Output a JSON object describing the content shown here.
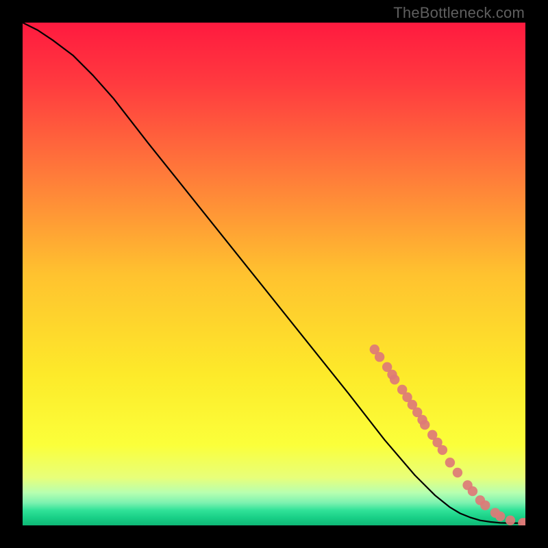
{
  "watermark": "TheBottleneck.com",
  "chart_data": {
    "type": "line",
    "title": "",
    "xlabel": "",
    "ylabel": "",
    "xlim": [
      0,
      100
    ],
    "ylim": [
      0,
      100
    ],
    "grid": false,
    "background_gradient": {
      "stops": [
        {
          "pos": 0.0,
          "color": "#ff1a3f"
        },
        {
          "pos": 0.12,
          "color": "#ff3a3f"
        },
        {
          "pos": 0.3,
          "color": "#ff7a3a"
        },
        {
          "pos": 0.5,
          "color": "#ffc22f"
        },
        {
          "pos": 0.7,
          "color": "#fdea2a"
        },
        {
          "pos": 0.84,
          "color": "#fbff3a"
        },
        {
          "pos": 0.905,
          "color": "#e8ff7a"
        },
        {
          "pos": 0.935,
          "color": "#b7ffb0"
        },
        {
          "pos": 0.955,
          "color": "#7cf2b0"
        },
        {
          "pos": 0.97,
          "color": "#30e298"
        },
        {
          "pos": 0.985,
          "color": "#18cf86"
        },
        {
          "pos": 1.0,
          "color": "#0fb876"
        }
      ]
    },
    "series": [
      {
        "name": "curve",
        "type": "line",
        "color": "#000000",
        "x": [
          0,
          3,
          6,
          10,
          14,
          18,
          25,
          35,
          45,
          55,
          65,
          72,
          78,
          82,
          85,
          87,
          89,
          91,
          93,
          95,
          97,
          99,
          100
        ],
        "y": [
          100,
          98.5,
          96.5,
          93.5,
          89.5,
          85,
          76,
          63.5,
          51,
          38.5,
          26,
          17,
          10,
          6,
          3.6,
          2.4,
          1.6,
          1.0,
          0.7,
          0.5,
          0.45,
          0.45,
          0.45
        ]
      },
      {
        "name": "markers",
        "type": "scatter",
        "color": "#dd7a77",
        "x": [
          70,
          71,
          72.5,
          73.5,
          74,
          75.5,
          76.5,
          77.5,
          78.5,
          79.5,
          80,
          81.5,
          82.5,
          83.5,
          85,
          86.5,
          88.5,
          89.5,
          91,
          92,
          94,
          95,
          97,
          99.5,
          100
        ],
        "y": [
          35,
          33.5,
          31.5,
          30,
          29,
          27,
          25.5,
          24,
          22.5,
          21,
          20,
          18,
          16.5,
          15,
          12.5,
          10.5,
          8,
          6.8,
          5,
          4,
          2.5,
          1.8,
          1.0,
          0.5,
          0.5
        ]
      }
    ]
  }
}
